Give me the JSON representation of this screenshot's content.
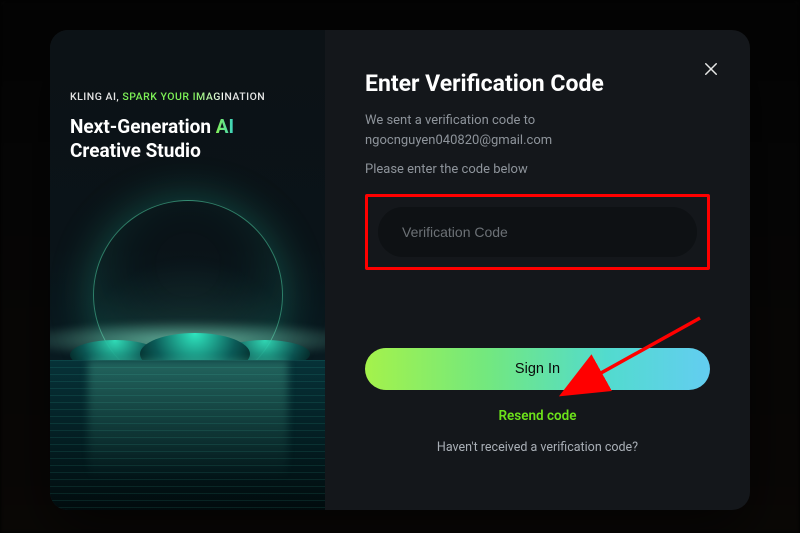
{
  "colors": {
    "accent_green": "#6ce21a",
    "gradient_start": "#a4f24b",
    "gradient_end": "#63cdf1",
    "highlight_red": "#ff0000"
  },
  "left": {
    "tagline_brand": "KLING AI, ",
    "tagline_spark": "SPARK YOUR ",
    "tagline_imagi": "IMAGI",
    "tagline_nation": "NATION",
    "headline_pre": "Next-Generation ",
    "headline_ai": "AI",
    "headline_post": "Creative Studio"
  },
  "right": {
    "title": "Enter Verification Code",
    "sent_line": "We sent a verification code to",
    "email": "ngocnguyen040820@gmail.com",
    "prompt": "Please enter the code below",
    "input_placeholder": "Verification Code",
    "input_value": "",
    "signin_label": "Sign In",
    "resend_label": "Resend code",
    "not_received": "Haven't received a verification code?"
  },
  "icons": {
    "close": "close-icon"
  }
}
